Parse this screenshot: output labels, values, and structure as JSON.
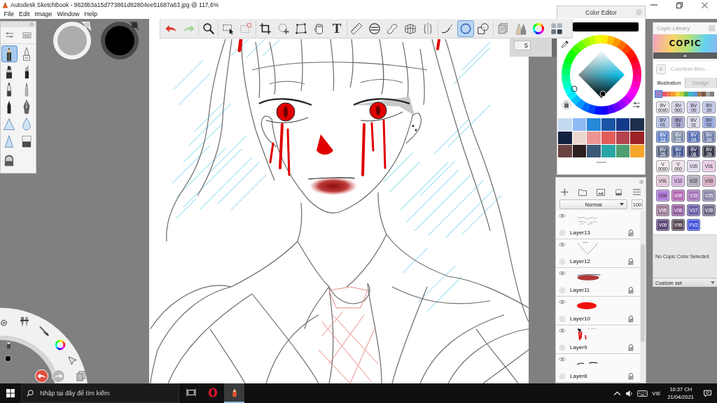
{
  "window": {
    "title": "Autodesk SketchBook - 9828b3a15d773861d82804ee51687a63.jpg @ 117,6%"
  },
  "menu": [
    {
      "label": "File"
    },
    {
      "label": "Edit"
    },
    {
      "label": "Image"
    },
    {
      "label": "Window"
    },
    {
      "label": "Help"
    }
  ],
  "toolbar": {
    "groups": [
      [
        {
          "kind": "undo",
          "selected": false
        },
        {
          "kind": "redo",
          "selected": false
        }
      ],
      [
        {
          "kind": "zoom",
          "selected": false
        }
      ],
      [
        {
          "kind": "rect_select",
          "selected": false
        },
        {
          "kind": "magic_select",
          "selected": false
        }
      ],
      [
        {
          "kind": "crop",
          "selected": false
        },
        {
          "kind": "move",
          "selected": false
        },
        {
          "kind": "distort",
          "selected": false
        },
        {
          "kind": "fill",
          "selected": false
        },
        {
          "kind": "text",
          "glyph": "T",
          "selected": false
        }
      ],
      [
        {
          "kind": "ruler",
          "selected": false
        },
        {
          "kind": "ellipse_guide",
          "selected": false
        },
        {
          "kind": "french_curve",
          "selected": false
        },
        {
          "kind": "perspective",
          "selected": false
        },
        {
          "kind": "symmetry",
          "selected": false
        }
      ],
      [
        {
          "kind": "stroke",
          "selected": false
        },
        {
          "kind": "ellipse",
          "selected": true
        },
        {
          "kind": "shapes",
          "selected": false
        }
      ],
      [
        {
          "kind": "copy",
          "selected": false
        },
        {
          "kind": "brushes",
          "selected": false
        },
        {
          "kind": "color_wheel",
          "selected": false
        },
        {
          "kind": "swatches",
          "selected": false
        }
      ]
    ]
  },
  "brush_properties": {
    "size": "5"
  },
  "brush_palette": {
    "brushes": [
      {
        "kind": "pencil",
        "selected": true
      },
      {
        "kind": "inker",
        "selected": false
      },
      {
        "kind": "marker",
        "selected": false
      },
      {
        "kind": "chisel",
        "selected": false
      },
      {
        "kind": "pen",
        "selected": false
      },
      {
        "kind": "airbrush",
        "selected": false
      },
      {
        "kind": "ballpoint",
        "selected": false
      },
      {
        "kind": "fountain",
        "selected": false
      },
      {
        "kind": "smudge",
        "selected": false
      },
      {
        "kind": "blur",
        "selected": false
      },
      {
        "kind": "sharpen",
        "selected": false
      },
      {
        "kind": "eraser",
        "selected": false
      },
      {
        "kind": "hard_eraser",
        "selected": false
      }
    ]
  },
  "color_editor": {
    "title": "Color Editor",
    "swatches": [
      {
        "color": "#c4daf0"
      },
      {
        "color": "#8fb9f3"
      },
      {
        "color": "#2588d8"
      },
      {
        "color": "#1a55a8"
      },
      {
        "color": "#143a8a"
      },
      {
        "color": "#1c2f4d"
      },
      {
        "color": "#132241"
      },
      {
        "color": "#ecd7d0"
      },
      {
        "color": "#ee9594"
      },
      {
        "color": "#e25c5c"
      },
      {
        "color": "#b4434f"
      },
      {
        "color": "#9c2325"
      },
      {
        "color": "#6b4242"
      },
      {
        "color": "#2f1e1e"
      },
      {
        "color": "#3c5878"
      },
      {
        "color": "#2aa6a6"
      },
      {
        "color": "#4f9e72"
      },
      {
        "color": "#f5a42c"
      }
    ]
  },
  "layer_editor": {
    "blend_mode": "Normal",
    "opacity": "100",
    "layers": [
      {
        "name": "Layer13"
      },
      {
        "name": "Layer12"
      },
      {
        "name": "Layer11"
      },
      {
        "name": "Layer10"
      },
      {
        "name": "Layer9"
      },
      {
        "name": "Layer8"
      }
    ]
  },
  "copic_library": {
    "title": "Copic Library",
    "logo": "COPIC",
    "blender": {
      "code": "0",
      "name": "Colorless Blen…"
    },
    "tabs": [
      {
        "label": "Illustration",
        "selected": true
      },
      {
        "label": "Design",
        "selected": false
      }
    ],
    "families": [
      {
        "color": "#9a88c8",
        "selected": true
      },
      {
        "color": "#e65a70",
        "selected": false
      },
      {
        "color": "#f07850",
        "selected": false
      },
      {
        "color": "#f4a030",
        "selected": false
      },
      {
        "color": "#f0d040",
        "selected": false
      },
      {
        "color": "#b8d040",
        "selected": false
      },
      {
        "color": "#50b060",
        "selected": false
      },
      {
        "color": "#40b8c8",
        "selected": false
      },
      {
        "color": "#5898d8",
        "selected": false
      },
      {
        "color": "#a07858",
        "selected": false
      },
      {
        "color": "#7a5a48",
        "selected": false
      },
      {
        "color": "#a8a8a8",
        "selected": false
      },
      {
        "color": "#808080",
        "selected": false
      }
    ],
    "markers": [
      {
        "lines": [
          "BV",
          "0000"
        ],
        "color": "#ebe8f2"
      },
      {
        "lines": [
          "BV",
          "000"
        ],
        "color": "#dcd8ec"
      },
      {
        "lines": [
          "BV",
          "00"
        ],
        "color": "#cfcde8"
      },
      {
        "lines": [
          "BV",
          "20"
        ],
        "color": "#c0c8e8"
      },
      {
        "lines": [
          "BV",
          "01"
        ],
        "color": "#b8c2e6"
      },
      {
        "lines": [
          "BV",
          "11"
        ],
        "color": "#a4a2cc"
      },
      {
        "lines": [
          "BV",
          "31"
        ],
        "color": "#dcdcec"
      },
      {
        "lines": [
          "BV",
          "02"
        ],
        "color": "#98aade"
      },
      {
        "lines": [
          "BV",
          "13"
        ],
        "color": "#6886c8"
      },
      {
        "lines": [
          "BV",
          "23"
        ],
        "color": "#8492aa"
      },
      {
        "lines": [
          "BV",
          "04"
        ],
        "color": "#5870b4"
      },
      {
        "lines": [
          "BV",
          "34"
        ],
        "color": "#7282aa"
      },
      {
        "lines": [
          "BV",
          "25"
        ],
        "color": "#5c6a86"
      },
      {
        "lines": [
          "BV",
          "17"
        ],
        "color": "#4a5e98"
      },
      {
        "lines": [
          "BV",
          "08"
        ],
        "color": "#3c3e64"
      },
      {
        "lines": [
          "BV",
          "29"
        ],
        "color": "#363948"
      },
      {
        "lines": [
          "V",
          "0000"
        ],
        "color": "#f4ecec"
      },
      {
        "lines": [
          "V",
          "000"
        ],
        "color": "#f0e2ea"
      },
      {
        "lines": [
          "V20"
        ],
        "color": "#e2dcec"
      },
      {
        "lines": [
          "V01"
        ],
        "color": "#eacce4"
      },
      {
        "lines": [
          "V91"
        ],
        "color": "#e2c8d6"
      },
      {
        "lines": [
          "V12"
        ],
        "color": "#d8b4de"
      },
      {
        "lines": [
          "V22"
        ],
        "color": "#b0acba"
      },
      {
        "lines": [
          "V93"
        ],
        "color": "#d8aec4"
      },
      {
        "lines": [
          "V04"
        ],
        "color": "#b07cd8"
      },
      {
        "lines": [
          "V05"
        ],
        "color": "#b468b4"
      },
      {
        "lines": [
          "V15"
        ],
        "color": "#a478b8"
      },
      {
        "lines": [
          "V25"
        ],
        "color": "#8c88a8"
      },
      {
        "lines": [
          "V95"
        ],
        "color": "#a07c96"
      },
      {
        "lines": [
          "V06"
        ],
        "color": "#94609e"
      },
      {
        "lines": [
          "V17"
        ],
        "color": "#6c62a8"
      },
      {
        "lines": [
          "V28"
        ],
        "color": "#706a8a"
      },
      {
        "lines": [
          "V09"
        ],
        "color": "#5c487a"
      },
      {
        "lines": [
          "V99"
        ],
        "color": "#5a4a58"
      },
      {
        "lines": [
          "FV2"
        ],
        "color": "#4858dc"
      }
    ],
    "status": "No Copic Color Selected",
    "set": "Custom set"
  },
  "taskbar": {
    "search": {
      "placeholder": "Nhập tại đây để tìm kiếm"
    },
    "apps": [
      {
        "kind": "task_view",
        "selected": false
      },
      {
        "kind": "opera",
        "selected": false
      },
      {
        "kind": "sketchbook",
        "selected": true
      }
    ],
    "language": "VIE",
    "time": "10:37 CH",
    "date": "21/04/2021"
  }
}
